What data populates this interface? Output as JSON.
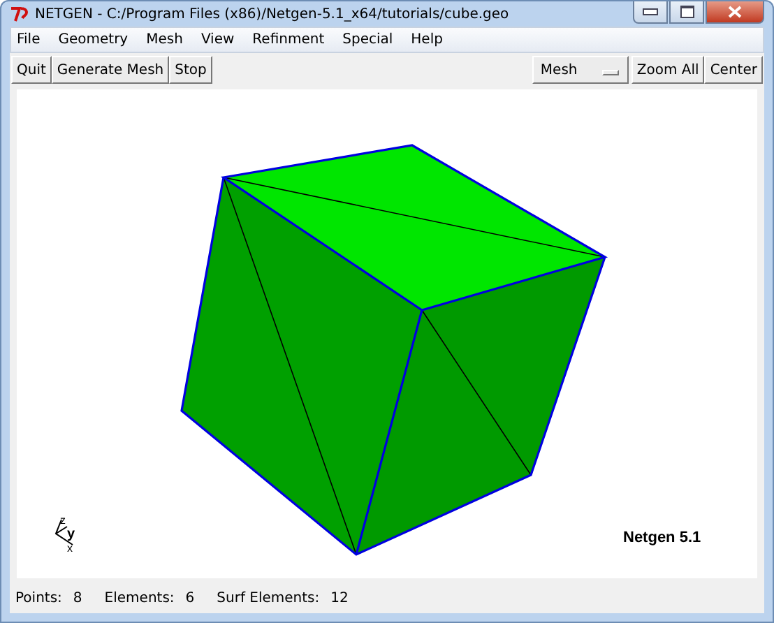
{
  "window": {
    "title": "NETGEN - C:/Program Files (x86)/Netgen-5.1_x64/tutorials/cube.geo"
  },
  "menu": [
    "File",
    "Geometry",
    "Mesh",
    "View",
    "Refinment",
    "Special",
    "Help"
  ],
  "toolbar": {
    "left_buttons": [
      "Quit",
      "Generate Mesh",
      "Stop"
    ],
    "view_select": "Mesh",
    "right_buttons": [
      "Zoom All",
      "Center"
    ]
  },
  "viewport": {
    "axis_labels": [
      "z",
      "y",
      "x"
    ],
    "version": "Netgen 5.1"
  },
  "status_bar": [
    {
      "label": "Points:",
      "value": "8"
    },
    {
      "label": "Elements:",
      "value": "6"
    },
    {
      "label": "Surf Elements:",
      "value": "12"
    }
  ]
}
